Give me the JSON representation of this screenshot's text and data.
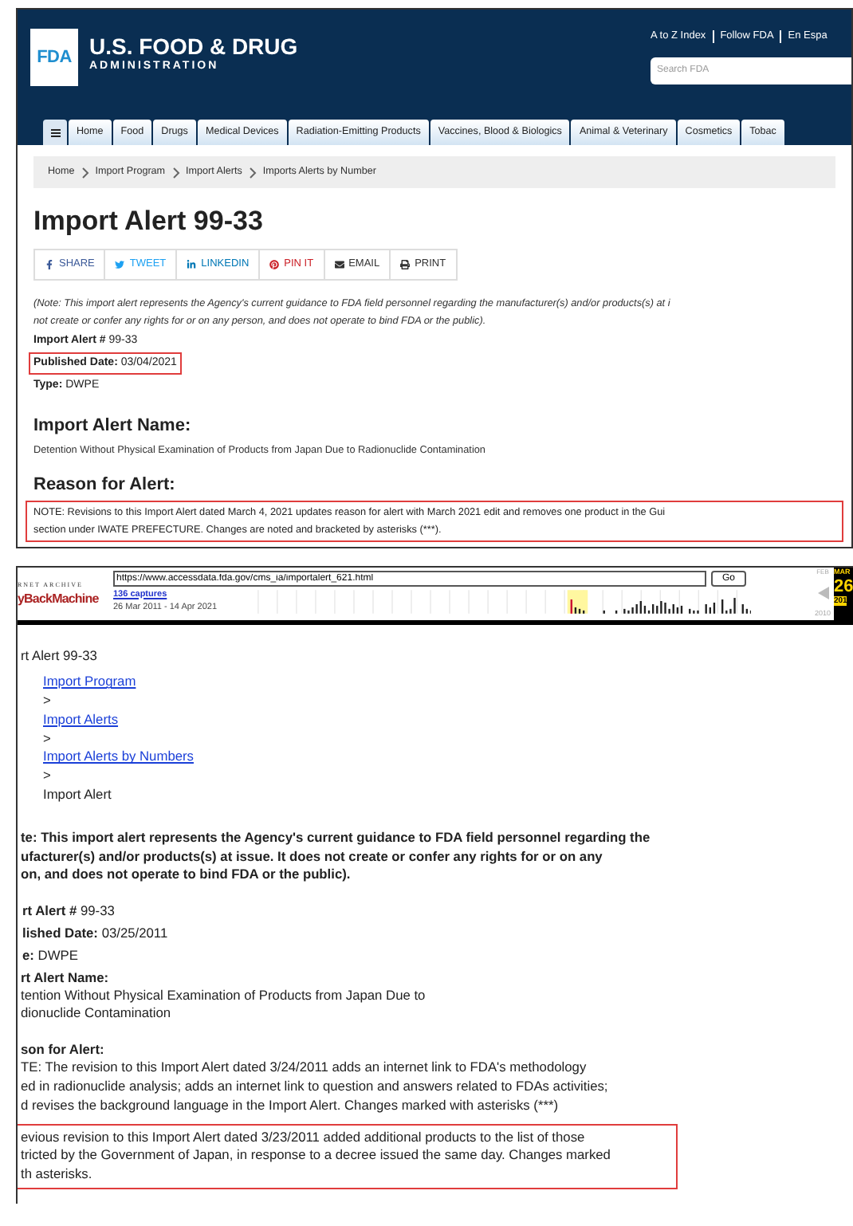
{
  "current_page": {
    "header": {
      "logo_mark": "FDA",
      "logo_title": "U.S. FOOD & DRUG",
      "logo_subtitle": "ADMINISTRATION",
      "top_links": [
        "A to Z Index",
        "Follow FDA",
        "En Espa"
      ],
      "search": {
        "placeholder": "Search FDA"
      }
    },
    "nav_tabs": [
      "Home",
      "Food",
      "Drugs",
      "Medical Devices",
      "Radiation-Emitting Products",
      "Vaccines, Blood & Biologics",
      "Animal & Veterinary",
      "Cosmetics",
      "Tobac"
    ],
    "breadcrumb": [
      "Home",
      "Import Program",
      "Import Alerts",
      "Imports Alerts by Number"
    ],
    "title": "Import Alert 99-33",
    "share_buttons": [
      {
        "kind": "facebook",
        "label": "SHARE"
      },
      {
        "kind": "twitter",
        "label": "TWEET"
      },
      {
        "kind": "linkedin",
        "label": "LINKEDIN"
      },
      {
        "kind": "pinterest",
        "label": "PIN IT"
      },
      {
        "kind": "email",
        "label": "EMAIL"
      },
      {
        "kind": "print",
        "label": "PRINT"
      }
    ],
    "note_lines": [
      "(Note: This import alert represents the Agency's current guidance to FDA field personnel regarding the manufacturer(s) and/or products(s) at i",
      "not create or confer any rights for or on any person, and does not operate to bind FDA or the public)."
    ],
    "fields": [
      {
        "label": "Import Alert #",
        "value": "99-33",
        "highlighted": false
      },
      {
        "label": "Published Date:",
        "value": "03/04/2021",
        "highlighted": true
      },
      {
        "label": "Type:",
        "value": "DWPE",
        "highlighted": false
      }
    ],
    "name_heading": "Import Alert Name:",
    "name_text": "Detention Without Physical Examination of Products from Japan Due to Radionuclide Contamination",
    "reason_heading": "Reason for Alert:",
    "reason_lines": [
      "NOTE: Revisions to this Import Alert dated March 4, 2021 updates reason for alert with March 2021 edit and removes one product in the Gui",
      "section under IWATE PREFECTURE. Changes are noted and bracketed by asterisks (***)."
    ]
  },
  "archived_page": {
    "toolbar": {
      "logo_top": "RNET ARCHIVE",
      "logo_name": "yBackMachine",
      "url": "https://www.accessdata.fda.gov/cms_ia/importalert_621.html",
      "go": "Go",
      "captures": "136 captures",
      "date_range": "26 Mar 2011 - 14 Apr 2021",
      "prev_month": "FEB",
      "current_month": "MAR",
      "current_day": "26",
      "prev_year": "2010",
      "current_year": "201"
    },
    "title": "rt Alert 99-33",
    "breadcrumb": [
      {
        "kind": "link",
        "text": "Import Program"
      },
      {
        "kind": "separator",
        "text": ">"
      },
      {
        "kind": "link",
        "text": "Import Alerts"
      },
      {
        "kind": "separator",
        "text": ">"
      },
      {
        "kind": "link",
        "text": "Import Alerts by Numbers"
      },
      {
        "kind": "separator",
        "text": ">"
      },
      {
        "kind": "plain",
        "text": "Import Alert"
      }
    ],
    "note_lines": [
      "te: This import alert represents the Agency's current guidance to FDA field personnel regarding the",
      "ufacturer(s) and/or products(s) at issue. It does not create or confer any rights for or on any",
      "on, and does not operate to bind FDA or the public)."
    ],
    "fields": [
      {
        "label": "rt Alert #",
        "value": "99-33",
        "highlighted": false
      },
      {
        "label": "lished Date:",
        "value": "03/25/2011",
        "highlighted": false
      },
      {
        "label": "e:",
        "value": "DWPE",
        "highlighted": false
      }
    ],
    "name_heading": "rt Alert Name:",
    "name_lines": [
      "tention Without Physical Examination of Products from Japan Due to",
      "dionuclide Contamination"
    ],
    "reason_heading": "son for Alert:",
    "reason_lines": [
      "TE: The revision to this Import Alert dated 3/24/2011 adds an internet link to FDA's methodology",
      "ed in radionuclide analysis; adds an internet link to question and answers related to FDAs activities;",
      "d revises the background language in the Import Alert. Changes marked with asterisks (***)"
    ],
    "previous_lines": [
      "evious revision to this Import Alert dated 3/23/2011 added additional products to the list of those",
      "tricted by the Government of Japan, in response to a decree issued the same day. Changes marked",
      "th asterisks."
    ],
    "previous_highlighted": true
  }
}
